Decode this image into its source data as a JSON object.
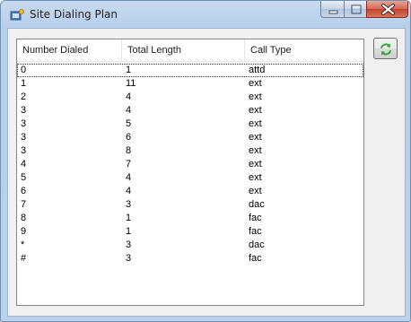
{
  "window": {
    "title": "Site Dialing Plan"
  },
  "table": {
    "columns": [
      "Number Dialed",
      "Total Length",
      "Call Type"
    ],
    "rows": [
      [
        "0",
        "1",
        "attd"
      ],
      [
        "1",
        "11",
        "ext"
      ],
      [
        "2",
        "4",
        "ext"
      ],
      [
        "3",
        "4",
        "ext"
      ],
      [
        "3",
        "5",
        "ext"
      ],
      [
        "3",
        "6",
        "ext"
      ],
      [
        "3",
        "8",
        "ext"
      ],
      [
        "4",
        "7",
        "ext"
      ],
      [
        "5",
        "4",
        "ext"
      ],
      [
        "6",
        "4",
        "ext"
      ],
      [
        "7",
        "3",
        "dac"
      ],
      [
        "8",
        "1",
        "fac"
      ],
      [
        "9",
        "1",
        "fac"
      ],
      [
        "*",
        "3",
        "dac"
      ],
      [
        "#",
        "3",
        "fac"
      ]
    ]
  },
  "icons": {
    "app": "app-icon",
    "refresh": "refresh-icon",
    "minimize": "minimize-icon",
    "maximize": "maximize-icon",
    "close": "close-icon"
  },
  "colors": {
    "refresh_green": "#3aa33a",
    "close_red": "#c2432b"
  }
}
